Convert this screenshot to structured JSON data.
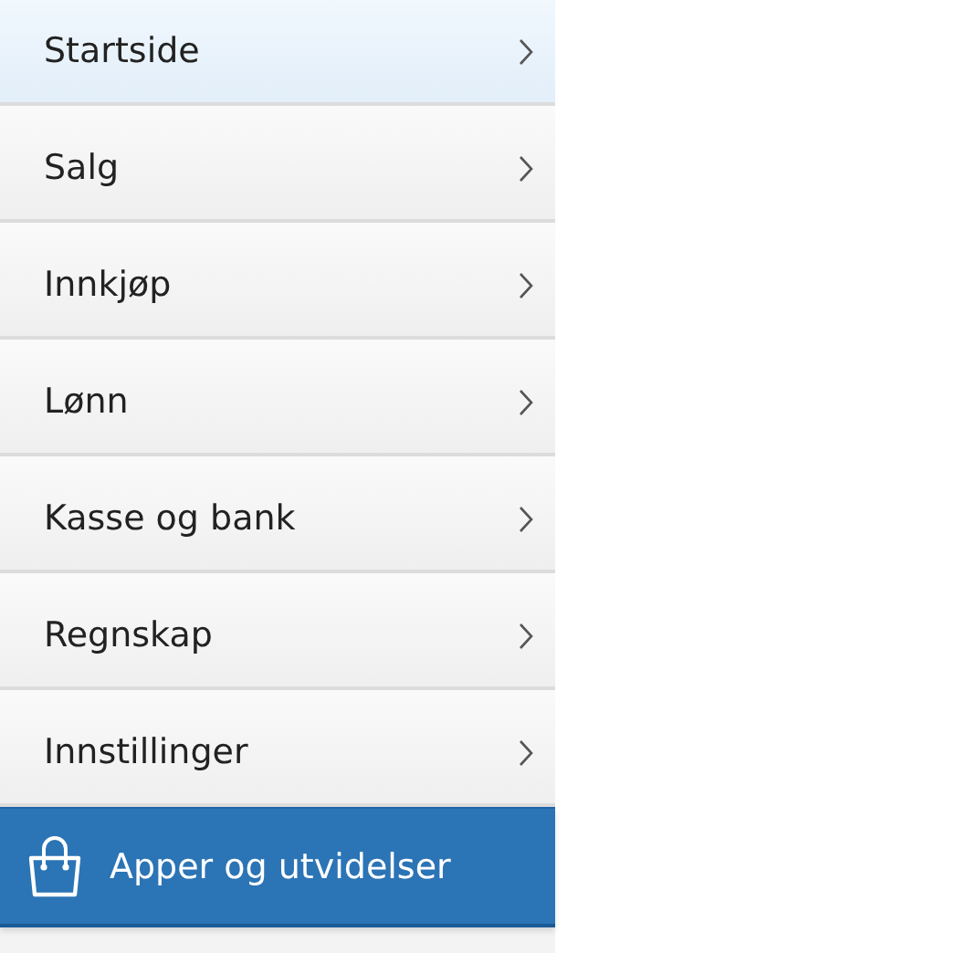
{
  "menu": {
    "items": [
      {
        "label": "Startside",
        "selected": true
      },
      {
        "label": "Salg",
        "selected": false
      },
      {
        "label": "Innkjøp",
        "selected": false
      },
      {
        "label": "Lønn",
        "selected": false
      },
      {
        "label": "Kasse og bank",
        "selected": false
      },
      {
        "label": "Regnskap",
        "selected": false
      },
      {
        "label": "Innstillinger",
        "selected": false
      }
    ]
  },
  "apps_button": {
    "label": "Apper og utvidelser"
  }
}
